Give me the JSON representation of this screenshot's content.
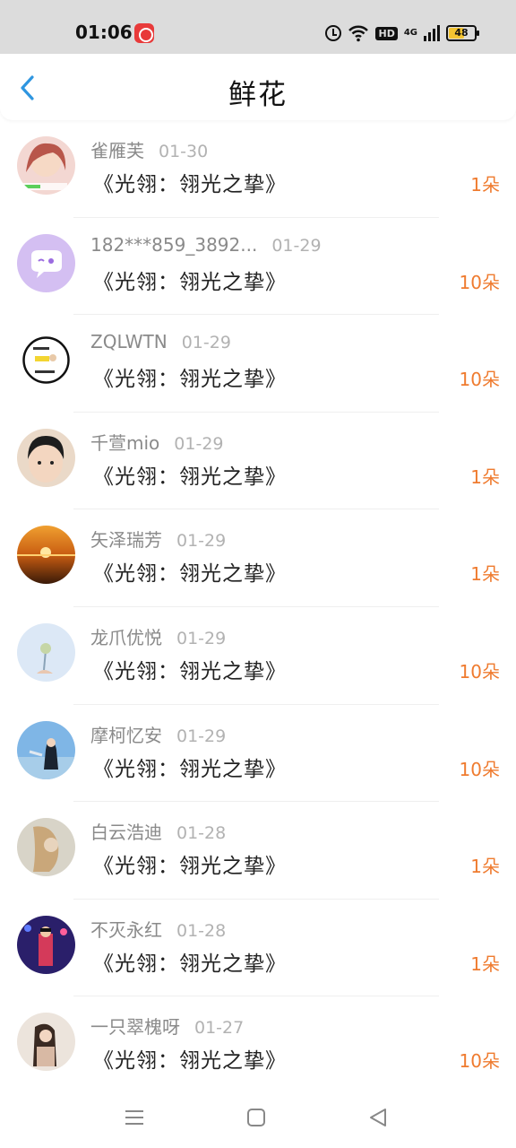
{
  "status_bar": {
    "time": "01:06",
    "network": "4G",
    "hd": "HD",
    "battery": "48"
  },
  "header": {
    "title": "鲜花",
    "back_icon": "chevron-left-icon"
  },
  "list": [
    {
      "name": "雀雁芙",
      "date": "01-30",
      "book": "《光翎：翎光之挚》",
      "count": "1朵"
    },
    {
      "name": "182***859_3892...",
      "date": "01-29",
      "book": "《光翎：翎光之挚》",
      "count": "10朵"
    },
    {
      "name": "ZQLWTN",
      "date": "01-29",
      "book": "《光翎：翎光之挚》",
      "count": "10朵"
    },
    {
      "name": "千萱mio",
      "date": "01-29",
      "book": "《光翎：翎光之挚》",
      "count": "1朵"
    },
    {
      "name": "矢泽瑞芳",
      "date": "01-29",
      "book": "《光翎：翎光之挚》",
      "count": "1朵"
    },
    {
      "name": "龙爪优悦",
      "date": "01-29",
      "book": "《光翎：翎光之挚》",
      "count": "10朵"
    },
    {
      "name": "摩柯忆安",
      "date": "01-29",
      "book": "《光翎：翎光之挚》",
      "count": "10朵"
    },
    {
      "name": "白云浩迪",
      "date": "01-28",
      "book": "《光翎：翎光之挚》",
      "count": "1朵"
    },
    {
      "name": "不灭永红",
      "date": "01-28",
      "book": "《光翎：翎光之挚》",
      "count": "1朵"
    },
    {
      "name": "一只翠槐呀",
      "date": "01-27",
      "book": "《光翎：翎光之挚》",
      "count": "10朵"
    }
  ],
  "nav": {
    "menu_icon": "menu-icon",
    "home_icon": "home-square-icon",
    "back_icon": "back-triangle-icon"
  },
  "colors": {
    "accent": "#2f96e0",
    "count": "#ef7b2f",
    "name": "#8a8a8a",
    "date": "#b2b2b2"
  }
}
